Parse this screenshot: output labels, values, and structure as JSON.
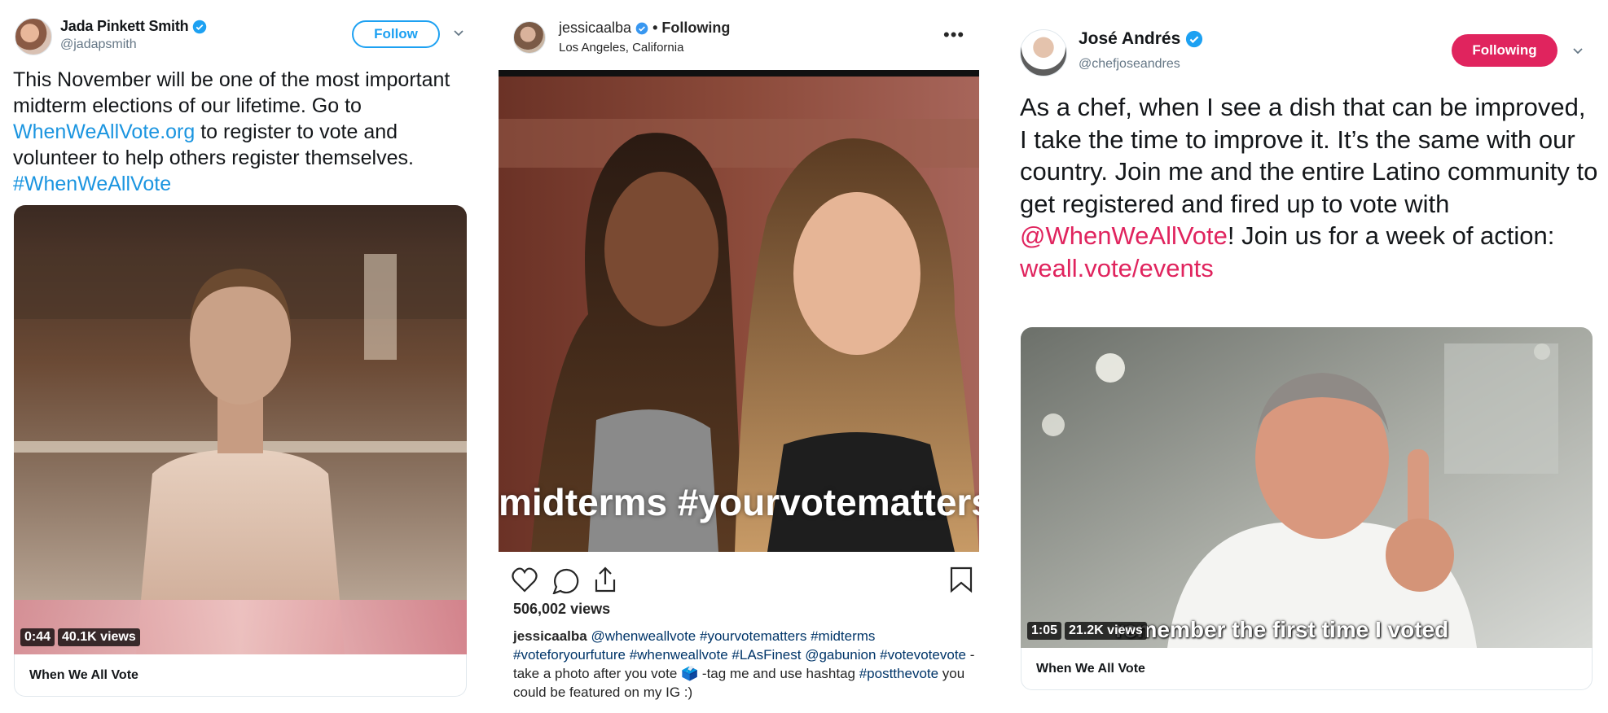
{
  "panel1": {
    "user_name": "Jada Pinkett Smith",
    "handle": "@jadapsmith",
    "follow_label": "Follow",
    "tweet": {
      "t1": "This November will be one of the most important midterm elections of our lifetime. Go to ",
      "link1": "WhenWeAllVote.org",
      "t2": " to register to vote and volunteer to help others register themselves. ",
      "hashtag": "#WhenWeAllVote"
    },
    "video_time": "0:44",
    "video_views": "40.1K views",
    "card_title": "When We All Vote"
  },
  "panel2": {
    "user_name": "jessicaalba",
    "following_label": "• Following",
    "location": "Los Angeles, California",
    "more_label": "•••",
    "overlay_text": "midterms #yourvotematters",
    "views": "506,002 views",
    "caption": {
      "user": "jessicaalba",
      "tag1": "@whenweallvote",
      "tag2": "#yourvotematters",
      "tag3": "#midterms",
      "tag4": "#voteforyourfuture",
      "tag5": "#whenweallvote",
      "tag6": "#LAsFinest",
      "tag7": "@gabunion",
      "tag8": "#votevotevote",
      "text1": " -take a photo after you vote 🗳️ -tag me and use hashtag ",
      "tag9": "#postthevote",
      "text2": " you could be featured on my IG :)"
    }
  },
  "panel3": {
    "user_name": "José Andrés",
    "handle": "@chefjoseandres",
    "following_label": "Following",
    "tweet": {
      "t1": "As a chef, when I see a dish that can be improved, I take the time to improve it. It’s the same with our country. Join me and the entire Latino community to get registered and fired up to vote with ",
      "mention": "@WhenWeAllVote",
      "t2": "! Join us for a week of action: ",
      "link": "weall.vote/events"
    },
    "video_time": "1:05",
    "video_views": "21.2K views",
    "subtitle": "remember the first time I voted",
    "card_title": "When We All Vote"
  },
  "colors": {
    "twitter_blue": "#1da1f2",
    "twitter_link": "#1b95e0",
    "pink_accent": "#e0245e",
    "instagram_tag": "#003569"
  },
  "icons": [
    "verified-badge-icon",
    "chevron-down-icon",
    "heart-icon",
    "comment-icon",
    "share-icon",
    "bookmark-icon",
    "more-icon"
  ]
}
